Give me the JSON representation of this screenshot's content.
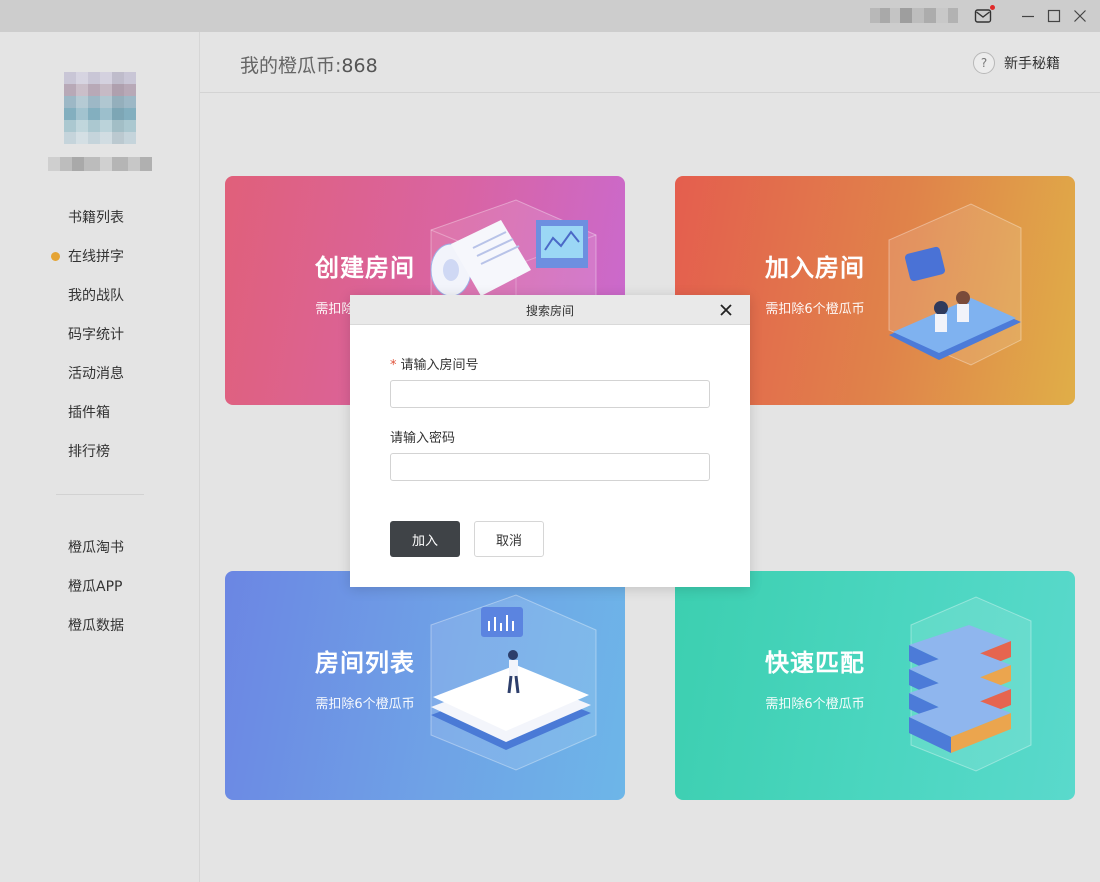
{
  "header": {
    "coins_label": "我的橙瓜币:",
    "coins_value": "868",
    "help_label": "新手秘籍",
    "help_icon": "?"
  },
  "sidebar": {
    "items": [
      {
        "label": "书籍列表",
        "active": false
      },
      {
        "label": "在线拼字",
        "active": true
      },
      {
        "label": "我的战队",
        "active": false
      },
      {
        "label": "码字统计",
        "active": false
      },
      {
        "label": "活动消息",
        "active": false
      },
      {
        "label": "插件箱",
        "active": false
      },
      {
        "label": "排行榜",
        "active": false
      }
    ],
    "extra_items": [
      {
        "label": "橙瓜淘书"
      },
      {
        "label": "橙瓜APP"
      },
      {
        "label": "橙瓜数据"
      }
    ]
  },
  "cards": [
    {
      "title": "创建房间",
      "subtitle": "需扣除6个橙瓜币",
      "icon": "document-scroll-icon"
    },
    {
      "title": "加入房间",
      "subtitle": "需扣除6个橙瓜币",
      "icon": "join-room-icon"
    },
    {
      "title": "房间列表",
      "subtitle": "需扣除6个橙瓜币",
      "icon": "room-list-icon"
    },
    {
      "title": "快速匹配",
      "subtitle": "需扣除6个橙瓜币",
      "icon": "server-stack-icon"
    }
  ],
  "modal": {
    "title": "搜索房间",
    "room_label": "请输入房间号",
    "room_required_mark": "*",
    "room_value": "",
    "password_label": "请输入密码",
    "password_value": "",
    "join_label": "加入",
    "cancel_label": "取消"
  },
  "colors": {
    "accent_dot": "#e5a434",
    "primary_button": "#3f4347",
    "required": "#e0533a"
  }
}
